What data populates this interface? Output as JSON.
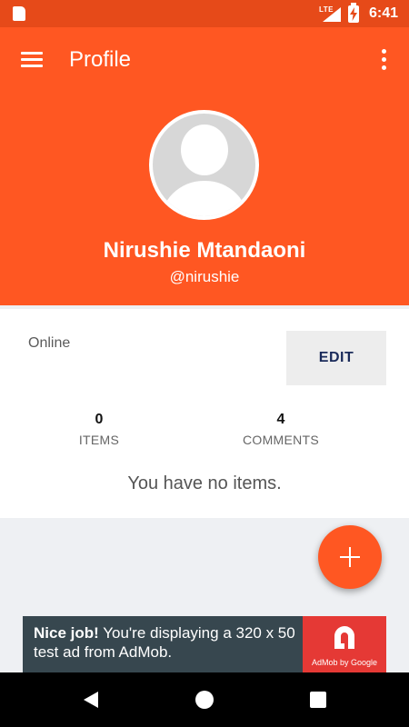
{
  "status_bar": {
    "network": "LTE",
    "time": "6:41",
    "icons": [
      "sd-card-icon",
      "signal-icon",
      "battery-charging-icon"
    ]
  },
  "app_bar": {
    "title": "Profile",
    "menu_icon": "hamburger-menu-icon",
    "overflow_icon": "more-vert-icon",
    "color": "#ff5722"
  },
  "profile": {
    "name": "Nirushie Mtandaoni",
    "handle": "@nirushie",
    "avatar_icon": "default-avatar-icon",
    "status": "Online",
    "edit_label": "EDIT"
  },
  "stats": {
    "items": {
      "count": "0",
      "label": "ITEMS"
    },
    "comments": {
      "count": "4",
      "label": "COMMENTS"
    }
  },
  "empty_message": "You have no items.",
  "fab": {
    "icon": "plus-icon"
  },
  "ad": {
    "headline": "Nice job!",
    "body": "You're displaying a 320 x 50 test ad from AdMob.",
    "brand": "AdMob by Google",
    "brand_color": "#e53935"
  },
  "nav_bar": {
    "icons": [
      "back-icon",
      "home-icon",
      "recents-icon"
    ]
  }
}
